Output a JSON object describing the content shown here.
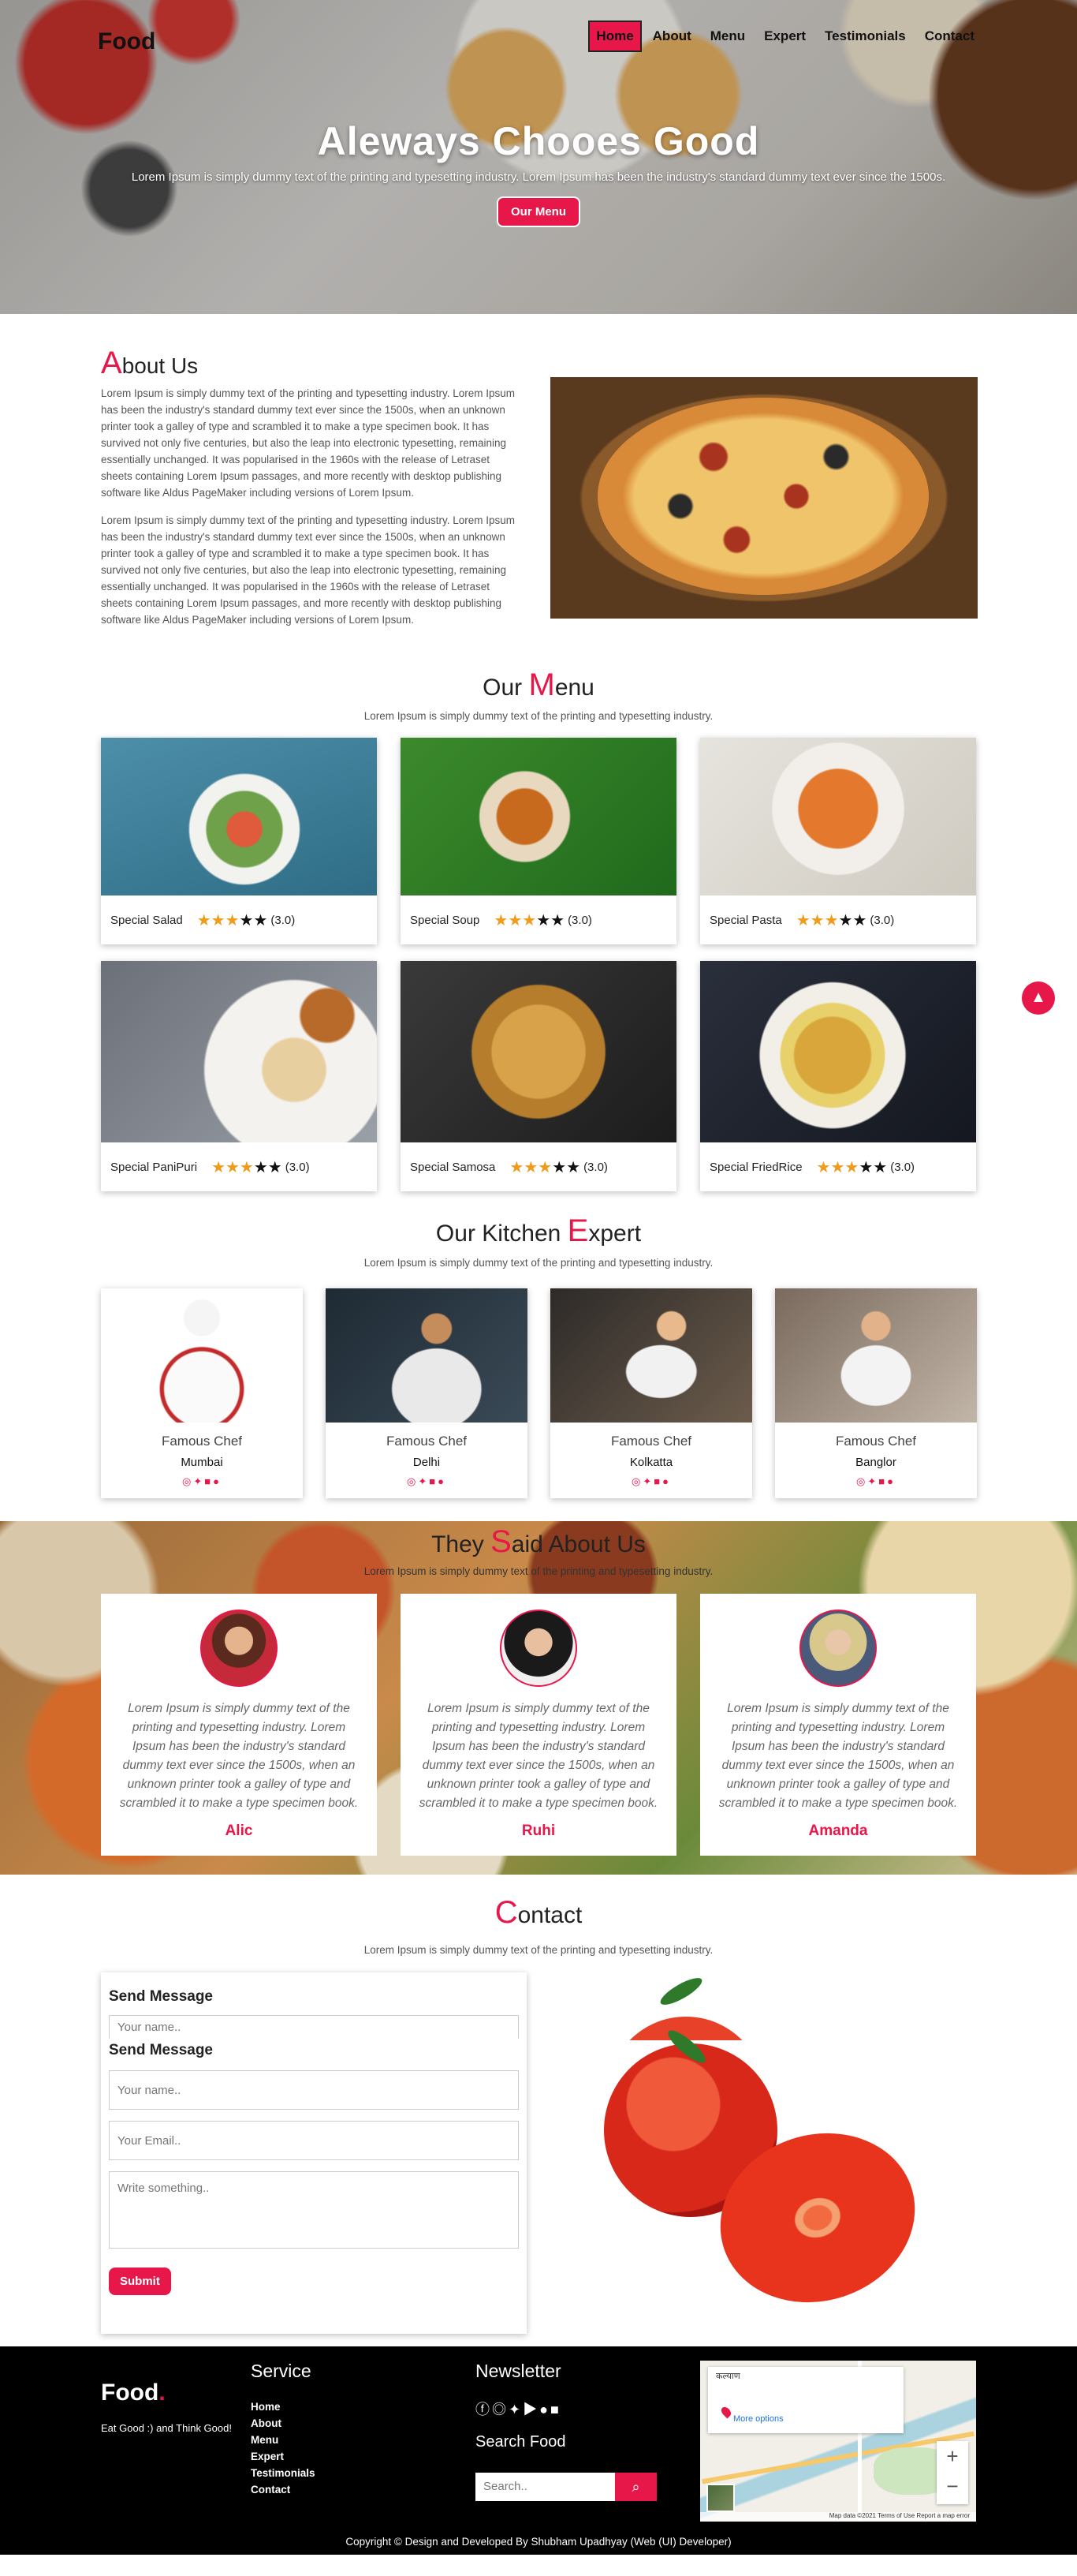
{
  "nav": {
    "logo": "Food",
    "items": [
      "Home",
      "About",
      "Menu",
      "Expert",
      "Testimonials",
      "Contact"
    ],
    "active": "Home"
  },
  "hero": {
    "title": "Aleways Chooes Good",
    "subtitle": "Lorem Ipsum is simply dummy text of the printing and typesetting industry. Lorem Ipsum has been the industry's standard dummy text ever since the 1500s.",
    "button": "Our Menu"
  },
  "about": {
    "heading_first": "A",
    "heading_rest": "bout Us",
    "paragraphs": [
      "Lorem Ipsum is simply dummy text of the printing and typesetting industry. Lorem Ipsum has been the industry's standard dummy text ever since the 1500s, when an unknown printer took a galley of type and scrambled it to make a type specimen book. It has survived not only five centuries, but also the leap into electronic typesetting, remaining essentially unchanged. It was popularised in the 1960s with the release of Letraset sheets containing Lorem Ipsum passages, and more recently with desktop publishing software like Aldus PageMaker including versions of Lorem Ipsum.",
      "Lorem Ipsum is simply dummy text of the printing and typesetting industry. Lorem Ipsum has been the industry's standard dummy text ever since the 1500s, when an unknown printer took a galley of type and scrambled it to make a type specimen book. It has survived not only five centuries, but also the leap into electronic typesetting, remaining essentially unchanged. It was popularised in the 1960s with the release of Letraset sheets containing Lorem Ipsum passages, and more recently with desktop publishing software like Aldus PageMaker including versions of Lorem Ipsum."
    ]
  },
  "menu": {
    "heading_before": "Our ",
    "heading_first": "M",
    "heading_rest": "enu",
    "subtitle": "Lorem Ipsum is simply dummy text of the printing and typesetting industry.",
    "items": [
      {
        "name": "Special Salad",
        "rating": "(3.0)",
        "stars": 3
      },
      {
        "name": "Special Soup",
        "rating": "(3.0)",
        "stars": 3
      },
      {
        "name": "Special Pasta",
        "rating": "(3.0)",
        "stars": 3
      },
      {
        "name": "Special PaniPuri",
        "rating": "(3.0)",
        "stars": 3
      },
      {
        "name": "Special Samosa",
        "rating": "(3.0)",
        "stars": 3
      },
      {
        "name": "Special FriedRice",
        "rating": "(3.0)",
        "stars": 3
      }
    ]
  },
  "expert": {
    "heading_before": "Our Kitchen ",
    "heading_first": "E",
    "heading_rest": "xpert",
    "subtitle": "Lorem Ipsum is simply dummy text of the printing and typesetting industry.",
    "chefs": [
      {
        "title": "Famous Chef",
        "city": "Mumbai"
      },
      {
        "title": "Famous Chef",
        "city": "Delhi"
      },
      {
        "title": "Famous Chef",
        "city": "Kolkatta"
      },
      {
        "title": "Famous Chef",
        "city": "Banglor"
      }
    ],
    "social_icons": [
      "instagram-icon",
      "twitter-icon",
      "linkedin-icon",
      "pinterest-icon"
    ]
  },
  "testimonials": {
    "heading_before": "They ",
    "heading_first": "S",
    "heading_rest": "aid About Us",
    "subtitle": "Lorem Ipsum is simply dummy text of the printing and typesetting industry.",
    "items": [
      {
        "name": "Alic",
        "quote": "Lorem Ipsum is simply dummy text of the printing and typesetting industry. Lorem Ipsum has been the industry's standard dummy text ever since the 1500s, when an unknown printer took a galley of type and scrambled it to make a type specimen book."
      },
      {
        "name": "Ruhi",
        "quote": "Lorem Ipsum is simply dummy text of the printing and typesetting industry. Lorem Ipsum has been the industry's standard dummy text ever since the 1500s, when an unknown printer took a galley of type and scrambled it to make a type specimen book."
      },
      {
        "name": "Amanda",
        "quote": "Lorem Ipsum is simply dummy text of the printing and typesetting industry. Lorem Ipsum has been the industry's standard dummy text ever since the 1500s, when an unknown printer took a galley of type and scrambled it to make a type specimen book."
      }
    ]
  },
  "contact": {
    "heading_first": "C",
    "heading_rest": "ontact",
    "subtitle": "Lorem Ipsum is simply dummy text of the printing and typesetting industry.",
    "form_title": "Send Message",
    "name_placeholder": "Your name..",
    "email_placeholder": "Your Email..",
    "message_placeholder": "Write something..",
    "submit": "Submit"
  },
  "footer": {
    "logo": "Food",
    "logo_dot": ".",
    "tagline": "Eat Good :) and Think Good!",
    "service_heading": "Service",
    "links": [
      "Home",
      "About",
      "Menu",
      "Expert",
      "Testimonials",
      "Contact"
    ],
    "newsletter_heading": "Newsletter",
    "social_icons": [
      "facebook-icon",
      "instagram-icon",
      "twitter-icon",
      "youtube-icon",
      "github-icon",
      "linkedin-icon"
    ],
    "search_heading": "Search Food",
    "search_placeholder": "Search..",
    "map": {
      "place_label": "कल्याण",
      "more_options": "More options",
      "attribution": "Map data ©2021  Terms of Use  Report a map error"
    },
    "copyright": "Copyright © Design and Developed By Shubham Upadhyay (Web (UI) Developer)"
  },
  "colors": {
    "accent": "#e8174a",
    "footer_bg": "#000000"
  }
}
